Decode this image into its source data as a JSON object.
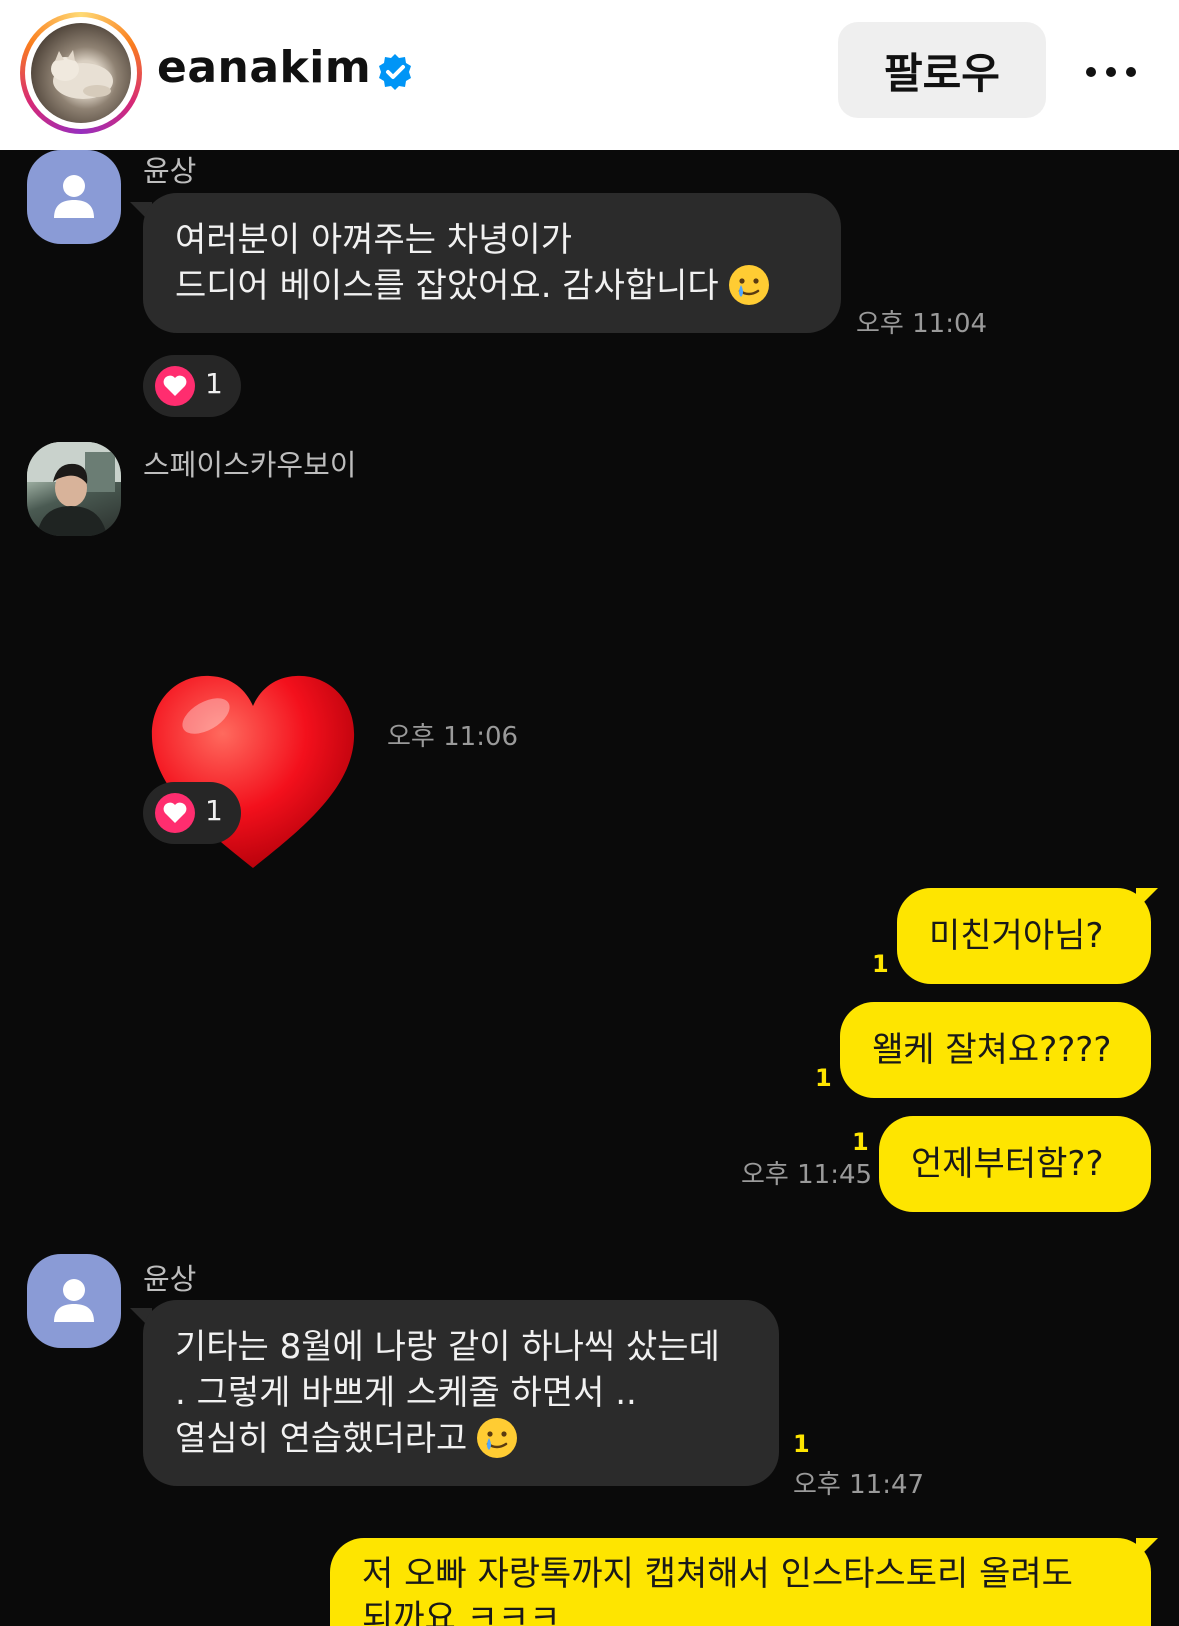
{
  "header": {
    "username": "eanakim",
    "follow_label": "팔로우",
    "verified_icon": "verified-badge-icon",
    "more_icon": "more-options-icon"
  },
  "colors": {
    "my_bubble": "#fee500",
    "their_bubble": "#2b2b2b",
    "reaction_heart": "#ff2d6f",
    "default_avatar": "#8a9bd6"
  },
  "messages": [
    {
      "sender": "윤상",
      "lines": [
        "여러분이 아껴주는 차녕이가",
        "드디어 베이스를 잡았어요. 감사합니다"
      ],
      "emoji": "crying-smile-emoji",
      "time": "오후 11:04",
      "reaction": {
        "icon": "heart-icon",
        "count": "1"
      }
    },
    {
      "sender": "스페이스카우보이",
      "sticker": "red-heart-emoji",
      "time": "오후 11:06",
      "reaction": {
        "icon": "heart-icon",
        "count": "1"
      }
    },
    {
      "outgoing": [
        {
          "text": "미친거아님?",
          "unread": "1"
        },
        {
          "text": "왤케 잘쳐요????",
          "unread": "1"
        },
        {
          "text": "언제부터함??",
          "unread": "1"
        }
      ],
      "time": "오후 11:45"
    },
    {
      "sender": "윤상",
      "lines": [
        "기타는 8월에 나랑 같이 하나씩 샀는데",
        ". 그렇게 바쁘게 스케줄 하면서 ..",
        "열심히 연습했더라고"
      ],
      "emoji": "crying-smile-emoji",
      "unread": "1",
      "time": "오후 11:47"
    },
    {
      "outgoing_partial": {
        "line1": "저 오빠 자랑톡까지 캡쳐해서 인스타스토리 올려도",
        "line2": "되까요 ㅋㅋㅋ"
      }
    }
  ]
}
